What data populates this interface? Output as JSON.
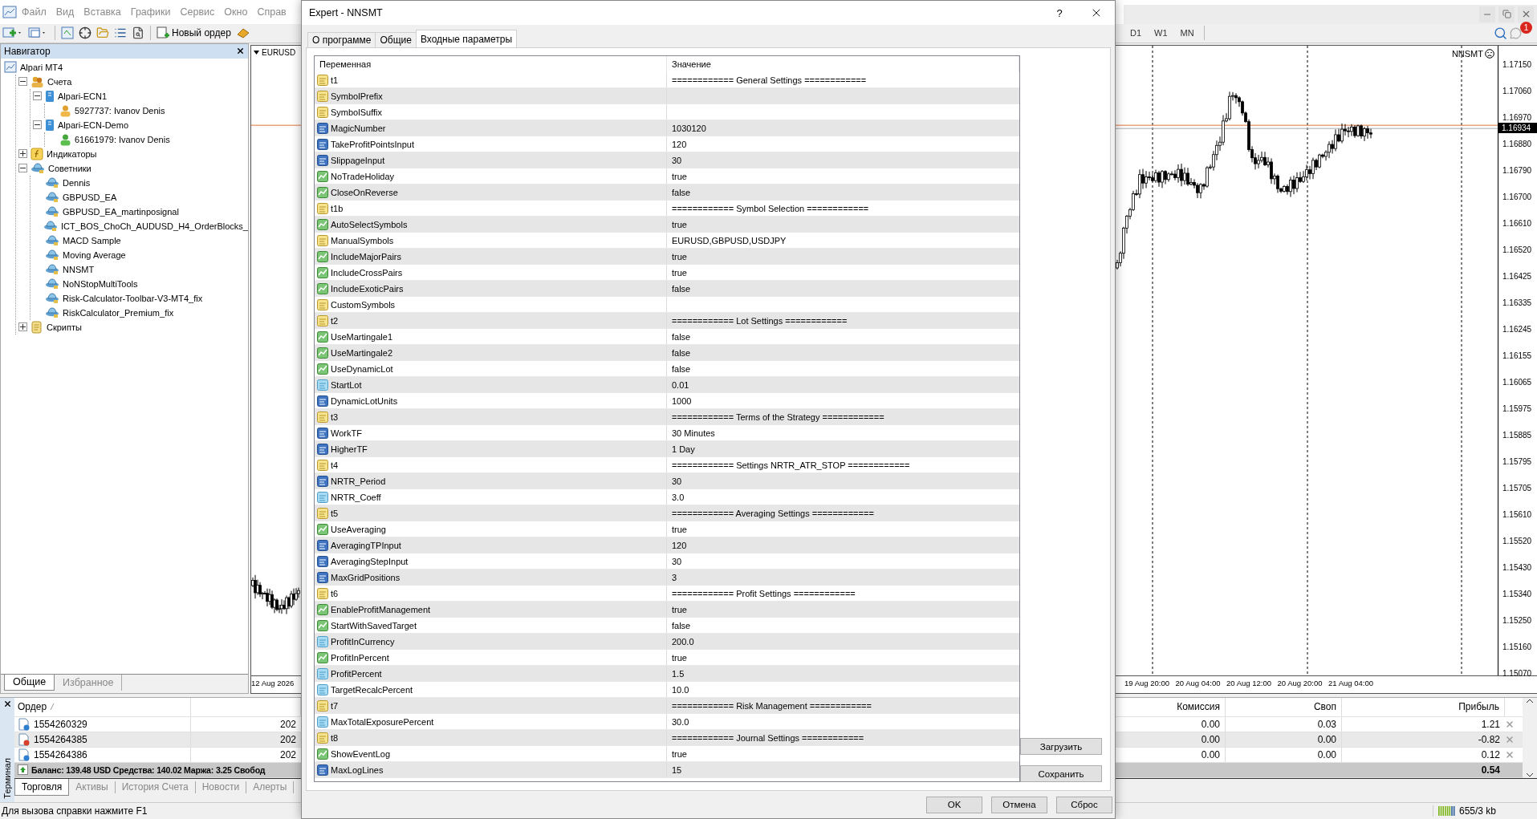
{
  "menu": [
    "Файл",
    "Вид",
    "Вставка",
    "Графики",
    "Сервис",
    "Окно",
    "Справ"
  ],
  "toolbar": {
    "new_order": "Новый ордер",
    "timeframes": [
      "D1",
      "W1",
      "MN"
    ],
    "notifications": "1"
  },
  "navigator": {
    "title": "Навигатор",
    "tree": [
      {
        "label": "Alpari MT4",
        "kind": "root",
        "children": [
          {
            "label": "Счета",
            "kind": "accounts",
            "expanded": true,
            "children": [
              {
                "label": "Alpari-ECN1",
                "kind": "server",
                "expanded": true,
                "children": [
                  {
                    "label": "5927737: Ivanov Denis",
                    "kind": "account",
                    "demo": false
                  }
                ]
              },
              {
                "label": "Alpari-ECN-Demo",
                "kind": "server",
                "expanded": true,
                "children": [
                  {
                    "label": "61661979: Ivanov Denis",
                    "kind": "account",
                    "demo": true
                  }
                ]
              }
            ]
          },
          {
            "label": "Индикаторы",
            "kind": "indicators",
            "expanded": false
          },
          {
            "label": "Советники",
            "kind": "experts",
            "expanded": true,
            "children": [
              {
                "label": "Dennis",
                "kind": "expert"
              },
              {
                "label": "GBPUSD_EA",
                "kind": "expert"
              },
              {
                "label": "GBPUSD_EA_martinposignal",
                "kind": "expert"
              },
              {
                "label": "ICT_BOS_ChoCh_AUDUSD_H4_OrderBlocks_",
                "kind": "expert"
              },
              {
                "label": "MACD Sample",
                "kind": "expert"
              },
              {
                "label": "Moving Average",
                "kind": "expert"
              },
              {
                "label": "NNSMT",
                "kind": "expert"
              },
              {
                "label": "NoNStopMultiTools",
                "kind": "expert"
              },
              {
                "label": "Risk-Calculator-Toolbar-V3-MT4_fix",
                "kind": "expert"
              },
              {
                "label": "RiskCalculator_Premium_fix",
                "kind": "expert"
              }
            ]
          },
          {
            "label": "Скрипты",
            "kind": "scripts",
            "expanded": false
          }
        ]
      }
    ],
    "tabs": [
      {
        "label": "Общие",
        "selected": true
      },
      {
        "label": "Избранное",
        "selected": false
      }
    ]
  },
  "chart": {
    "symbol": "EURUSD",
    "indicator": "NNSMT",
    "current_price": "1.16934",
    "price_labels": [
      "1.17150",
      "1.17060",
      "1.16970",
      "1.16880",
      "1.16790",
      "1.16700",
      "1.16610",
      "1.16520",
      "1.16425",
      "1.16335",
      "1.16245",
      "1.16155",
      "1.16065",
      "1.15975",
      "1.15885",
      "1.15795",
      "1.15705",
      "1.15610",
      "1.15520",
      "1.15430",
      "1.15340",
      "1.15250",
      "1.15160",
      "1.15070"
    ],
    "time_labels_left": [
      "12 Aug 2026"
    ],
    "time_labels_right": [
      "19 Aug 20:00",
      "20 Aug 04:00",
      "20 Aug 12:00",
      "20 Aug 20:00",
      "21 Aug 04:00"
    ]
  },
  "terminal": {
    "title": "Терминал",
    "order_column": "Ордер",
    "right_columns": [
      "Комиссия",
      "Своп",
      "Прибыль"
    ],
    "rows": [
      {
        "order": "1554260329",
        "kind": "buy",
        "time": "202",
        "commission": "0.00",
        "swap": "0.03",
        "profit": "1.21"
      },
      {
        "order": "1554264385",
        "kind": "sell",
        "time": "202",
        "commission": "0.00",
        "swap": "0.00",
        "profit": "-0.82"
      },
      {
        "order": "1554264386",
        "kind": "buy",
        "time": "202",
        "commission": "0.00",
        "swap": "0.00",
        "profit": "0.12"
      }
    ],
    "summary": "Баланс: 139.48 USD Средства: 140.02 Маржа: 3.25 Свобод",
    "total": "0.54",
    "tabs": [
      {
        "label": "Торговля",
        "selected": true
      },
      {
        "label": "Активы",
        "selected": false
      },
      {
        "label": "История Счета",
        "selected": false
      },
      {
        "label": "Новости",
        "selected": false
      },
      {
        "label": "Алерты",
        "selected": false
      }
    ]
  },
  "status_bar": {
    "help": "Для вызова справки нажмите F1",
    "traffic": "655/3 kb"
  },
  "dialog": {
    "title": "Expert - NNSMT",
    "help": "?",
    "tabs": [
      {
        "label": "О программе",
        "selected": false
      },
      {
        "label": "Общие",
        "selected": false
      },
      {
        "label": "Входные параметры",
        "selected": true
      }
    ],
    "columns": [
      "Переменная",
      "Значение"
    ],
    "params": [
      {
        "name": "t1",
        "kind": "string",
        "value": "============ General Settings ============"
      },
      {
        "name": "SymbolPrefix",
        "kind": "string"
      },
      {
        "name": "SymbolSuffix",
        "kind": "string"
      },
      {
        "name": "MagicNumber",
        "kind": "int",
        "value": "1030120"
      },
      {
        "name": "TakeProfitPointsInput",
        "kind": "int",
        "value": "120"
      },
      {
        "name": "SlippageInput",
        "kind": "int",
        "value": "30"
      },
      {
        "name": "NoTradeHoliday",
        "kind": "bool",
        "value": "true"
      },
      {
        "name": "CloseOnReverse",
        "kind": "bool",
        "value": "false"
      },
      {
        "name": "t1b",
        "kind": "string",
        "value": "============ Symbol Selection ============"
      },
      {
        "name": "AutoSelectSymbols",
        "kind": "bool",
        "value": "true"
      },
      {
        "name": "ManualSymbols",
        "kind": "string",
        "value": "EURUSD,GBPUSD,USDJPY"
      },
      {
        "name": "IncludeMajorPairs",
        "kind": "bool",
        "value": "true"
      },
      {
        "name": "IncludeCrossPairs",
        "kind": "bool",
        "value": "true"
      },
      {
        "name": "IncludeExoticPairs",
        "kind": "bool",
        "value": "false"
      },
      {
        "name": "CustomSymbols",
        "kind": "string"
      },
      {
        "name": "t2",
        "kind": "string",
        "value": "============ Lot Settings ============"
      },
      {
        "name": "UseMartingale1",
        "kind": "bool",
        "value": "false"
      },
      {
        "name": "UseMartingale2",
        "kind": "bool",
        "value": "false"
      },
      {
        "name": "UseDynamicLot",
        "kind": "bool",
        "value": "false"
      },
      {
        "name": "StartLot",
        "kind": "double",
        "value": "0.01"
      },
      {
        "name": "DynamicLotUnits",
        "kind": "int",
        "value": "1000"
      },
      {
        "name": "t3",
        "kind": "string",
        "value": "============ Terms of the Strategy ============"
      },
      {
        "name": "WorkTF",
        "kind": "int",
        "value": "30 Minutes"
      },
      {
        "name": "HigherTF",
        "kind": "int",
        "value": "1 Day"
      },
      {
        "name": "t4",
        "kind": "string",
        "value": "============ Settings NRTR_ATR_STOP ============"
      },
      {
        "name": "NRTR_Period",
        "kind": "int",
        "value": "30"
      },
      {
        "name": "NRTR_Coeff",
        "kind": "double",
        "value": "3.0"
      },
      {
        "name": "t5",
        "kind": "string",
        "value": "============ Averaging Settings ============"
      },
      {
        "name": "UseAveraging",
        "kind": "bool",
        "value": "true"
      },
      {
        "name": "AveragingTPInput",
        "kind": "int",
        "value": "120"
      },
      {
        "name": "AveragingStepInput",
        "kind": "int",
        "value": "30"
      },
      {
        "name": "MaxGridPositions",
        "kind": "int",
        "value": "3"
      },
      {
        "name": "t6",
        "kind": "string",
        "value": "============ Profit Settings ============"
      },
      {
        "name": "EnableProfitManagement",
        "kind": "bool",
        "value": "true"
      },
      {
        "name": "StartWithSavedTarget",
        "kind": "bool",
        "value": "false"
      },
      {
        "name": "ProfitInCurrency",
        "kind": "double",
        "value": "200.0"
      },
      {
        "name": "ProfitInPercent",
        "kind": "bool",
        "value": "true"
      },
      {
        "name": "ProfitPercent",
        "kind": "double",
        "value": "1.5"
      },
      {
        "name": "TargetRecalcPercent",
        "kind": "double",
        "value": "10.0"
      },
      {
        "name": "t7",
        "kind": "string",
        "value": "============ Risk Management ============"
      },
      {
        "name": "MaxTotalExposurePercent",
        "kind": "double",
        "value": "30.0"
      },
      {
        "name": "t8",
        "kind": "string",
        "value": "============ Journal Settings ============"
      },
      {
        "name": "ShowEventLog",
        "kind": "bool",
        "value": "true"
      },
      {
        "name": "MaxLogLines",
        "kind": "int",
        "value": "15"
      }
    ],
    "side_buttons": [
      "Загрузить",
      "Сохранить"
    ],
    "buttons": [
      "OK",
      "Отмена",
      "Сброс"
    ]
  }
}
